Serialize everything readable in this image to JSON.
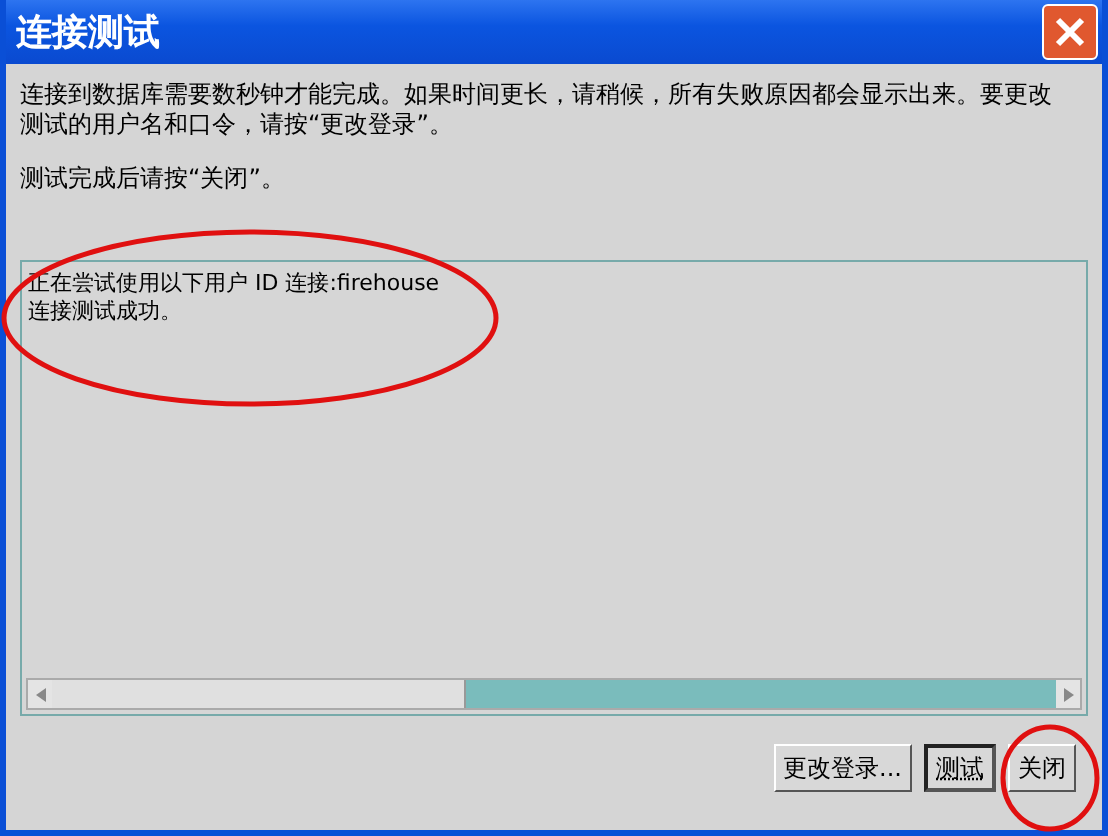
{
  "window": {
    "title": "连接测试"
  },
  "message": "连接到数据库需要数秒钟才能完成。如果时间更长，请稍候，所有失败原因都会显示出来。要更改测试的用户名和口令，请按“更改登录”。",
  "hint": "测试完成后请按“关闭”。",
  "log": [
    "正在尝试使用以下用户 ID 连接:firehouse",
    "连接测试成功。"
  ],
  "buttons": [
    {
      "label": "更改登录...",
      "default": false
    },
    {
      "label": "测试",
      "default": true
    },
    {
      "label": "关闭",
      "default": false
    }
  ]
}
